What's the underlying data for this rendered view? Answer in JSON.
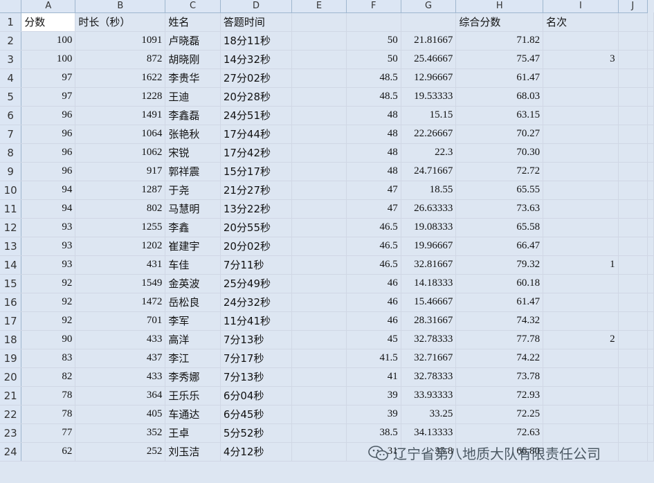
{
  "columns": [
    "A",
    "B",
    "C",
    "D",
    "E",
    "F",
    "G",
    "H",
    "I",
    "J"
  ],
  "header_row": [
    "分数",
    "时长（秒）",
    "姓名",
    "答题时间",
    "",
    "",
    "",
    "综合分数",
    "名次",
    ""
  ],
  "rows": [
    [
      "100",
      "1091",
      "卢晓磊",
      "18分11秒",
      "",
      "50",
      "21.81667",
      "71.82",
      "",
      ""
    ],
    [
      "100",
      "872",
      "胡晓刚",
      "14分32秒",
      "",
      "50",
      "25.46667",
      "75.47",
      "3",
      ""
    ],
    [
      "97",
      "1622",
      "李贵华",
      "27分02秒",
      "",
      "48.5",
      "12.96667",
      "61.47",
      "",
      ""
    ],
    [
      "97",
      "1228",
      "王迪",
      "20分28秒",
      "",
      "48.5",
      "19.53333",
      "68.03",
      "",
      ""
    ],
    [
      "96",
      "1491",
      "李鑫磊",
      "24分51秒",
      "",
      "48",
      "15.15",
      "63.15",
      "",
      ""
    ],
    [
      "96",
      "1064",
      "张艳秋",
      "17分44秒",
      "",
      "48",
      "22.26667",
      "70.27",
      "",
      ""
    ],
    [
      "96",
      "1062",
      "宋锐",
      "17分42秒",
      "",
      "48",
      "22.3",
      "70.30",
      "",
      ""
    ],
    [
      "96",
      "917",
      "郭祥震",
      "15分17秒",
      "",
      "48",
      "24.71667",
      "72.72",
      "",
      ""
    ],
    [
      "94",
      "1287",
      "于尧",
      "21分27秒",
      "",
      "47",
      "18.55",
      "65.55",
      "",
      ""
    ],
    [
      "94",
      "802",
      "马慧明",
      "13分22秒",
      "",
      "47",
      "26.63333",
      "73.63",
      "",
      ""
    ],
    [
      "93",
      "1255",
      "李鑫",
      "20分55秒",
      "",
      "46.5",
      "19.08333",
      "65.58",
      "",
      ""
    ],
    [
      "93",
      "1202",
      "崔建宇",
      "20分02秒",
      "",
      "46.5",
      "19.96667",
      "66.47",
      "",
      ""
    ],
    [
      "93",
      "431",
      "车佳",
      "7分11秒",
      "",
      "46.5",
      "32.81667",
      "79.32",
      "1",
      ""
    ],
    [
      "92",
      "1549",
      "金英波",
      "25分49秒",
      "",
      "46",
      "14.18333",
      "60.18",
      "",
      ""
    ],
    [
      "92",
      "1472",
      "岳松良",
      "24分32秒",
      "",
      "46",
      "15.46667",
      "61.47",
      "",
      ""
    ],
    [
      "92",
      "701",
      "李军",
      "11分41秒",
      "",
      "46",
      "28.31667",
      "74.32",
      "",
      ""
    ],
    [
      "90",
      "433",
      "高洋",
      "7分13秒",
      "",
      "45",
      "32.78333",
      "77.78",
      "2",
      ""
    ],
    [
      "83",
      "437",
      "李江",
      "7分17秒",
      "",
      "41.5",
      "32.71667",
      "74.22",
      "",
      ""
    ],
    [
      "82",
      "433",
      "李秀娜",
      "7分13秒",
      "",
      "41",
      "32.78333",
      "73.78",
      "",
      ""
    ],
    [
      "78",
      "364",
      "王乐乐",
      "6分04秒",
      "",
      "39",
      "33.93333",
      "72.93",
      "",
      ""
    ],
    [
      "78",
      "405",
      "车通达",
      "6分45秒",
      "",
      "39",
      "33.25",
      "72.25",
      "",
      ""
    ],
    [
      "77",
      "352",
      "王卓",
      "5分52秒",
      "",
      "38.5",
      "34.13333",
      "72.63",
      "",
      ""
    ],
    [
      "62",
      "252",
      "刘玉洁",
      "4分12秒",
      "",
      "31",
      "35.8",
      "66.80",
      "",
      ""
    ]
  ],
  "watermark": {
    "text": "辽宁省第八地质大队有限责任公司",
    "icon": "wechat-icon"
  }
}
